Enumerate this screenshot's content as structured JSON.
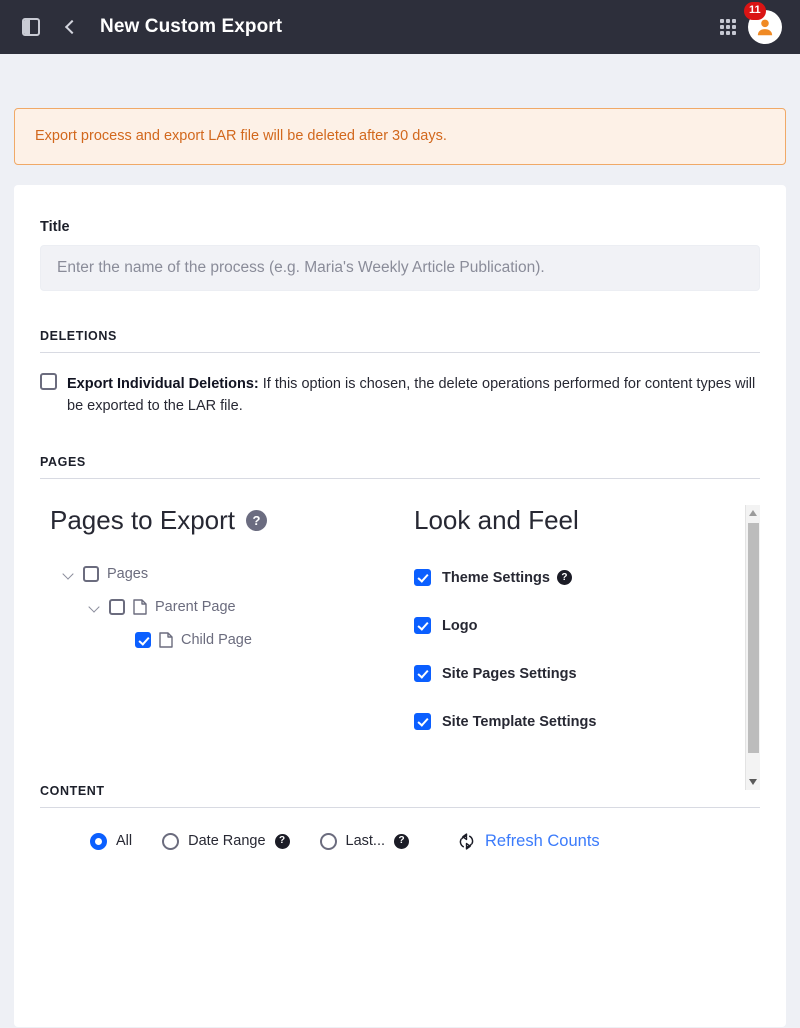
{
  "header": {
    "title": "New Custom Export",
    "sidebar_toggle_icon": "sidebar-toggle-icon",
    "back_icon": "chevron-left-icon",
    "apps_icon": "grid-apps-icon",
    "notification_count": "11",
    "avatar_icon": "user-avatar-icon"
  },
  "alert": {
    "message": "Export process and export LAR file will be deleted after 30 days.",
    "border_color": "#f0a967",
    "background_color": "#fdf1e7",
    "text_color": "#d2681d"
  },
  "form": {
    "title_label": "Title",
    "title_value": "",
    "title_placeholder": "Enter the name of the process (e.g. Maria's Weekly Article Publication)."
  },
  "deletions": {
    "section_label": "DELETIONS",
    "checkbox_checked": false,
    "label_bold": "Export Individual Deletions:",
    "label_rest": " If this option is chosen, the delete operations performed for content types will be exported to the LAR file."
  },
  "pages": {
    "section_label": "PAGES",
    "panel_title": "Pages to Export",
    "help_icon": "help-question-icon",
    "tree": [
      {
        "label": "Pages",
        "depth": 1,
        "checked": false,
        "expanded": true,
        "has_doc_icon": false
      },
      {
        "label": "Parent Page",
        "depth": 2,
        "checked": false,
        "expanded": true,
        "has_doc_icon": true
      },
      {
        "label": "Child Page",
        "depth": 3,
        "checked": true,
        "expanded": false,
        "has_doc_icon": true
      }
    ]
  },
  "look_and_feel": {
    "panel_title": "Look and Feel",
    "items": [
      {
        "label": "Theme Settings",
        "checked": true,
        "has_help": true
      },
      {
        "label": "Logo",
        "checked": true,
        "has_help": false
      },
      {
        "label": "Site Pages Settings",
        "checked": true,
        "has_help": false
      },
      {
        "label": "Site Template Settings",
        "checked": true,
        "has_help": false
      }
    ],
    "scrollbar": {
      "up_arrow_icon": "scroll-up-arrow-icon",
      "down_arrow_icon": "scroll-down-arrow-icon"
    }
  },
  "content": {
    "section_label": "CONTENT",
    "options": [
      {
        "label": "All",
        "selected": true,
        "has_help": false
      },
      {
        "label": "Date Range",
        "selected": false,
        "has_help": true
      },
      {
        "label": "Last...",
        "selected": false,
        "has_help": true
      }
    ],
    "refresh_label": "Refresh Counts",
    "refresh_icon": "refresh-circular-arrows-icon",
    "refresh_color": "#3b7bfb"
  },
  "theme": {
    "header_bg": "#2d2f3b",
    "page_bg": "#eef0f5",
    "accent_blue": "#0b5fff",
    "badge_red": "#da1414"
  }
}
